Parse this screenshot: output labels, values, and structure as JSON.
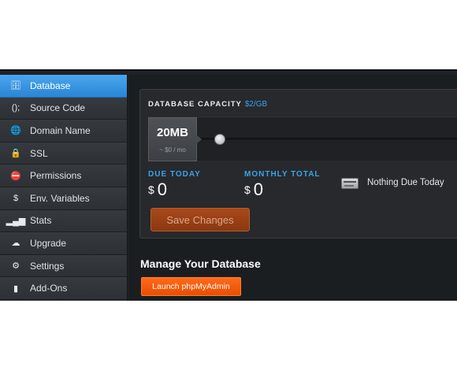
{
  "sidebar": {
    "items": [
      {
        "label": "Database",
        "icon": "database-icon",
        "glyph": "🗄",
        "active": true
      },
      {
        "label": "Source Code",
        "icon": "code-icon",
        "glyph": "();",
        "active": false
      },
      {
        "label": "Domain Name",
        "icon": "globe-icon",
        "glyph": "🌐",
        "active": false
      },
      {
        "label": "SSL",
        "icon": "lock-icon",
        "glyph": "🔒",
        "active": false
      },
      {
        "label": "Permissions",
        "icon": "minus-circle-icon",
        "glyph": "⛔",
        "active": false
      },
      {
        "label": "Env. Variables",
        "icon": "dollar-circle-icon",
        "glyph": "$",
        "active": false
      },
      {
        "label": "Stats",
        "icon": "bar-chart-icon",
        "glyph": "▂▄▆",
        "active": false
      },
      {
        "label": "Upgrade",
        "icon": "cloud-upload-icon",
        "glyph": "☁",
        "active": false
      },
      {
        "label": "Settings",
        "icon": "gear-icon",
        "glyph": "⚙",
        "active": false
      },
      {
        "label": "Add-Ons",
        "icon": "briefcase-icon",
        "glyph": "▮",
        "active": false
      }
    ]
  },
  "capacity": {
    "title": "DATABASE CAPACITY",
    "rate": "$2/GB",
    "size": "20MB",
    "price": "~ $0 / mo",
    "slider_fraction": 0.0
  },
  "billing": {
    "due_today_label": "DUE TODAY",
    "due_today_currency": "$",
    "due_today_value": "0",
    "monthly_label": "MONTHLY TOTAL",
    "monthly_currency": "$",
    "monthly_value": "0",
    "nothing_due": "Nothing Due Today"
  },
  "actions": {
    "save": "Save Changes",
    "manage_title": "Manage Your Database",
    "launch": "Launch phpMyAdmin"
  }
}
